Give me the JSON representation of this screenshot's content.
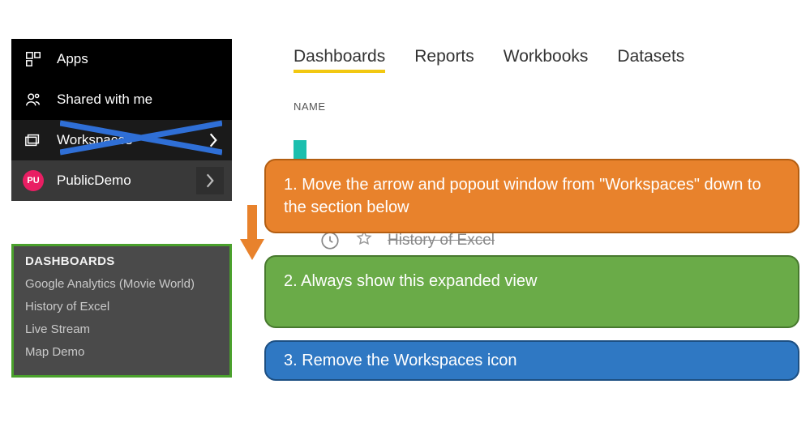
{
  "sidebar": {
    "apps": "Apps",
    "shared": "Shared with me",
    "workspaces": "Workspaces",
    "avatar_label": "PU",
    "current_ws": "PublicDemo"
  },
  "popup": {
    "title": "DASHBOARDS",
    "items": [
      "Google Analytics (Movie World)",
      "History of Excel",
      "Live Stream",
      "Map Demo"
    ]
  },
  "tabs": {
    "dashboards": "Dashboards",
    "reports": "Reports",
    "workbooks": "Workbooks",
    "datasets": "Datasets"
  },
  "content": {
    "name_header": "NAME",
    "row_text": "History of Excel"
  },
  "callouts": {
    "orange": "1.  Move the arrow and popout window from \"Workspaces\" down to the section below",
    "green": "2.  Always show this expanded view",
    "blue": "3.  Remove the Workspaces icon"
  }
}
